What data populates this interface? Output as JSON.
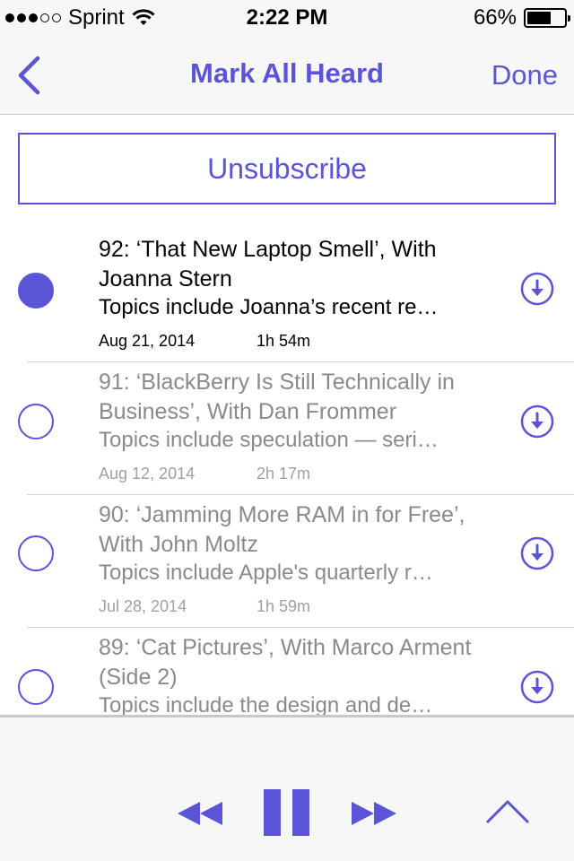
{
  "status_bar": {
    "carrier": "Sprint",
    "time": "2:22 PM",
    "battery_percent_label": "66%",
    "battery_level": 0.66,
    "signal_bars_filled": 3,
    "signal_bars_total": 5
  },
  "nav": {
    "back_icon": "chevron-left-icon",
    "title": "Mark All Heard",
    "done_label": "Done"
  },
  "unsubscribe_label": "Unsubscribe",
  "episodes": [
    {
      "title": "92: ‘That New Laptop Smell’, With Joanna Stern",
      "description": "Topics include Joanna’s recent re…",
      "date": "Aug 21, 2014",
      "duration": "1h 54m",
      "heard": false
    },
    {
      "title": "91: ‘BlackBerry Is Still Technically in Business’, With Dan Frommer",
      "description": "Topics include speculation — seri…",
      "date": "Aug 12, 2014",
      "duration": "2h 17m",
      "heard": true
    },
    {
      "title": "90: ‘Jamming More RAM in for Free’, With John Moltz",
      "description": "Topics include Apple's quarterly r…",
      "date": "Jul 28, 2014",
      "duration": "1h 59m",
      "heard": true
    },
    {
      "title": "89: ‘Cat Pictures’, With Marco Arment (Side 2)",
      "description": "Topics include the design and de…",
      "date": "",
      "duration": "",
      "heard": true
    }
  ],
  "player": {
    "rewind_icon": "rewind-icon",
    "pause_icon": "pause-icon",
    "fast_forward_icon": "fast-forward-icon",
    "expand_icon": "chevron-up-icon"
  },
  "colors": {
    "accent": "#5a55d6",
    "heard_text": "#8a8a8e",
    "separator": "#d6d6d8",
    "bar_background": "#f7f7f7"
  }
}
